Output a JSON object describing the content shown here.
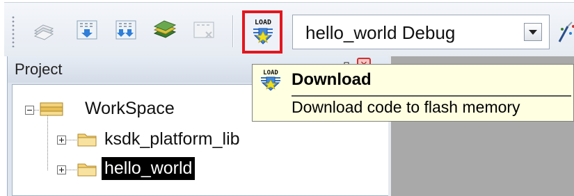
{
  "toolbar": {
    "icons": [
      "translate-icon",
      "build-icon",
      "rebuild-icon",
      "batch-build-icon",
      "stop-build-icon"
    ],
    "download_button": {
      "icon_text": "LOAD"
    },
    "target": {
      "selected": "hello_world Debug"
    }
  },
  "project_panel": {
    "title": "Project",
    "tree": {
      "root": "WorkSpace",
      "children": [
        {
          "label": "ksdk_platform_lib",
          "expanded": false,
          "selected": false
        },
        {
          "label": "hello_world",
          "expanded": false,
          "selected": true
        }
      ]
    }
  },
  "tooltip": {
    "icon_text": "LOAD",
    "title": "Download",
    "description": "Download code to flash memory"
  },
  "colors": {
    "highlight_border": "#e3161e",
    "tooltip_bg": "#ffffe1",
    "selection_bg": "#000000",
    "editor_bg": "#a9a9a9"
  }
}
